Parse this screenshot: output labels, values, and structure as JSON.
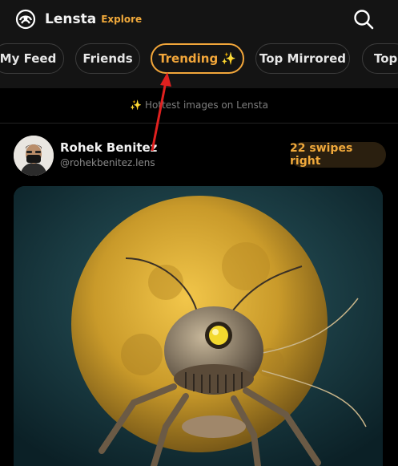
{
  "app": {
    "name": "Lensta",
    "section": "Explore"
  },
  "header": {
    "logo_icon": "lensta-logo-icon",
    "search_icon": "search-icon"
  },
  "tabs": [
    {
      "label": "My Feed",
      "active": false
    },
    {
      "label": "Friends",
      "active": false
    },
    {
      "label": "Trending",
      "icon": "✨",
      "active": true
    },
    {
      "label": "Top Mirrored",
      "active": false
    },
    {
      "label": "Top C",
      "active": false
    }
  ],
  "hint": {
    "icon": "✨",
    "text": "Hottest images on Lensta"
  },
  "post": {
    "author_name": "Rohek Benitez",
    "author_handle": "@rohekbenitez.lens",
    "badge": "22 swipes right",
    "image_icon": "robot-spider-moon-artwork"
  },
  "colors": {
    "accent": "#f2a63a",
    "background": "#000000",
    "header": "#141414",
    "annotation_arrow": "#e0201f"
  }
}
